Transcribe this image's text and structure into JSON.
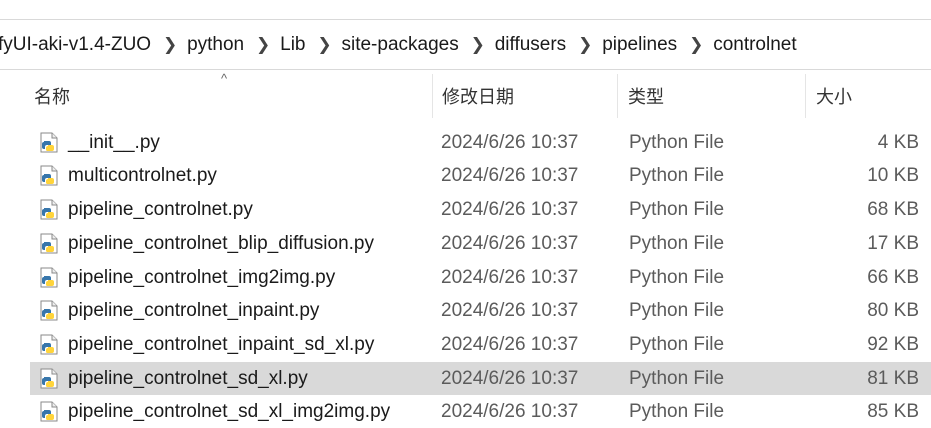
{
  "breadcrumb": {
    "items": [
      "fyUI-aki-v1.4-ZUO",
      "python",
      "Lib",
      "site-packages",
      "diffusers",
      "pipelines",
      "controlnet"
    ],
    "separator_icon": "chevron-right-icon"
  },
  "columns": {
    "name": "名称",
    "date": "修改日期",
    "type": "类型",
    "size": "大小",
    "sort_indicator": "^"
  },
  "files": [
    {
      "name": "__init__.py",
      "date": "2024/6/26 10:37",
      "type": "Python File",
      "size": "4 KB",
      "icon": "python-file-icon",
      "selected": false
    },
    {
      "name": "multicontrolnet.py",
      "date": "2024/6/26 10:37",
      "type": "Python File",
      "size": "10 KB",
      "icon": "python-file-icon",
      "selected": false
    },
    {
      "name": "pipeline_controlnet.py",
      "date": "2024/6/26 10:37",
      "type": "Python File",
      "size": "68 KB",
      "icon": "python-file-icon",
      "selected": false
    },
    {
      "name": "pipeline_controlnet_blip_diffusion.py",
      "date": "2024/6/26 10:37",
      "type": "Python File",
      "size": "17 KB",
      "icon": "python-file-icon",
      "selected": false
    },
    {
      "name": "pipeline_controlnet_img2img.py",
      "date": "2024/6/26 10:37",
      "type": "Python File",
      "size": "66 KB",
      "icon": "python-file-icon",
      "selected": false
    },
    {
      "name": "pipeline_controlnet_inpaint.py",
      "date": "2024/6/26 10:37",
      "type": "Python File",
      "size": "80 KB",
      "icon": "python-file-icon",
      "selected": false
    },
    {
      "name": "pipeline_controlnet_inpaint_sd_xl.py",
      "date": "2024/6/26 10:37",
      "type": "Python File",
      "size": "92 KB",
      "icon": "python-file-icon",
      "selected": false
    },
    {
      "name": "pipeline_controlnet_sd_xl.py",
      "date": "2024/6/26 10:37",
      "type": "Python File",
      "size": "81 KB",
      "icon": "python-file-icon",
      "selected": true
    },
    {
      "name": "pipeline_controlnet_sd_xl_img2img.py",
      "date": "2024/6/26 10:37",
      "type": "Python File",
      "size": "85 KB",
      "icon": "python-file-icon",
      "selected": false
    }
  ],
  "colors": {
    "selected_row": "#d9d9d9",
    "python_blue": "#3776ab",
    "python_yellow": "#ffd43b"
  }
}
